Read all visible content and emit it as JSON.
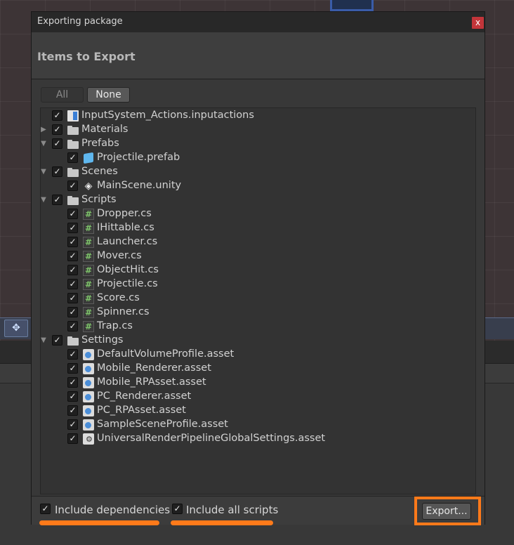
{
  "dialog": {
    "title": "Exporting package",
    "close_label": "x",
    "header": "Items to Export",
    "btn_all": "All",
    "btn_none": "None"
  },
  "tree": [
    {
      "label": "InputSystem_Actions.inputactions",
      "icon": "inputactions-icon",
      "depth": 0,
      "foldout": "",
      "checked": true
    },
    {
      "label": "Materials",
      "icon": "folder-icon",
      "depth": 0,
      "foldout": "collapsed",
      "checked": true
    },
    {
      "label": "Prefabs",
      "icon": "folder-icon",
      "depth": 0,
      "foldout": "expanded",
      "checked": true
    },
    {
      "label": "Projectile.prefab",
      "icon": "prefab-icon",
      "depth": 1,
      "foldout": "",
      "checked": true
    },
    {
      "label": "Scenes",
      "icon": "folder-icon",
      "depth": 0,
      "foldout": "expanded",
      "checked": true
    },
    {
      "label": "MainScene.unity",
      "icon": "unity-scene-icon",
      "depth": 1,
      "foldout": "",
      "checked": true
    },
    {
      "label": "Scripts",
      "icon": "folder-icon",
      "depth": 0,
      "foldout": "expanded",
      "checked": true
    },
    {
      "label": "Dropper.cs",
      "icon": "csharp-script-icon",
      "depth": 1,
      "foldout": "",
      "checked": true
    },
    {
      "label": "IHittable.cs",
      "icon": "csharp-script-icon",
      "depth": 1,
      "foldout": "",
      "checked": true
    },
    {
      "label": "Launcher.cs",
      "icon": "csharp-script-icon",
      "depth": 1,
      "foldout": "",
      "checked": true
    },
    {
      "label": "Mover.cs",
      "icon": "csharp-script-icon",
      "depth": 1,
      "foldout": "",
      "checked": true
    },
    {
      "label": "ObjectHit.cs",
      "icon": "csharp-script-icon",
      "depth": 1,
      "foldout": "",
      "checked": true
    },
    {
      "label": "Projectile.cs",
      "icon": "csharp-script-icon",
      "depth": 1,
      "foldout": "",
      "checked": true
    },
    {
      "label": "Score.cs",
      "icon": "csharp-script-icon",
      "depth": 1,
      "foldout": "",
      "checked": true
    },
    {
      "label": "Spinner.cs",
      "icon": "csharp-script-icon",
      "depth": 1,
      "foldout": "",
      "checked": true
    },
    {
      "label": "Trap.cs",
      "icon": "csharp-script-icon",
      "depth": 1,
      "foldout": "",
      "checked": true
    },
    {
      "label": "Settings",
      "icon": "folder-icon",
      "depth": 0,
      "foldout": "expanded",
      "checked": true
    },
    {
      "label": "DefaultVolumeProfile.asset",
      "icon": "asset-icon",
      "depth": 1,
      "foldout": "",
      "checked": true
    },
    {
      "label": "Mobile_Renderer.asset",
      "icon": "asset-icon",
      "depth": 1,
      "foldout": "",
      "checked": true
    },
    {
      "label": "Mobile_RPAsset.asset",
      "icon": "asset-icon",
      "depth": 1,
      "foldout": "",
      "checked": true
    },
    {
      "label": "PC_Renderer.asset",
      "icon": "asset-icon",
      "depth": 1,
      "foldout": "",
      "checked": true
    },
    {
      "label": "PC_RPAsset.asset",
      "icon": "asset-icon",
      "depth": 1,
      "foldout": "",
      "checked": true
    },
    {
      "label": "SampleSceneProfile.asset",
      "icon": "asset-icon",
      "depth": 1,
      "foldout": "",
      "checked": true
    },
    {
      "label": "UniversalRenderPipelineGlobalSettings.asset",
      "icon": "settings-asset-icon",
      "depth": 1,
      "foldout": "",
      "checked": true
    }
  ],
  "footer": {
    "include_dependencies": "Include dependencies",
    "include_all_scripts": "Include all scripts",
    "export_label": "Export..."
  },
  "colors": {
    "highlight": "#ff7a1a",
    "close_button": "#c2353a"
  }
}
